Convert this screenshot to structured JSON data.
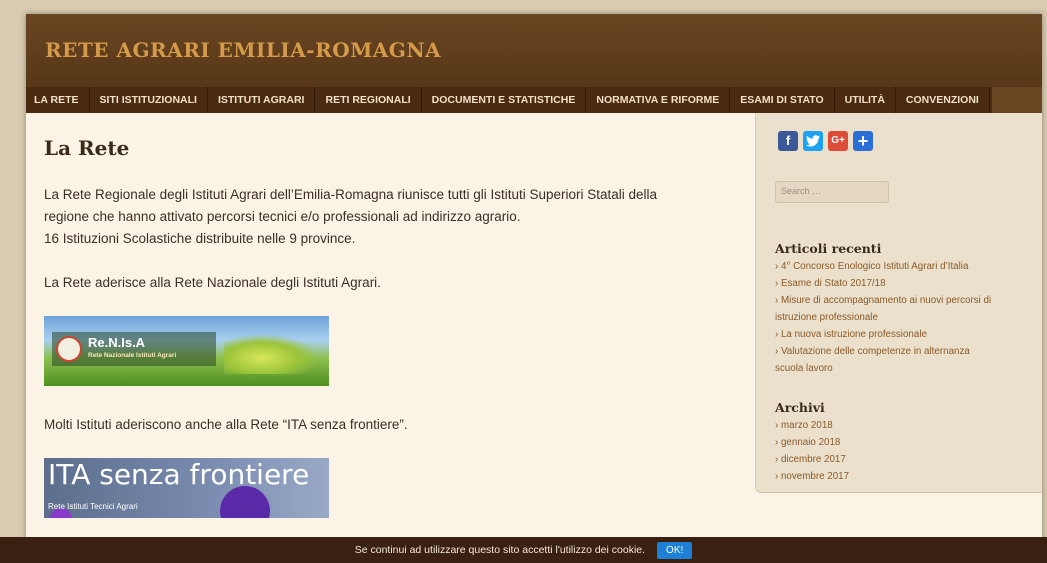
{
  "site": {
    "title": "RETE AGRARI EMILIA-ROMAGNA"
  },
  "nav": {
    "items": [
      "LA RETE",
      "SITI ISTITUZIONALI",
      "ISTITUTI AGRARI",
      "RETI REGIONALI",
      "DOCUMENTI E STATISTICHE",
      "NORMATIVA E RIFORME",
      "ESAMI DI STATO",
      "UTILITÀ",
      "CONVENZIONI"
    ]
  },
  "main": {
    "title": "La Rete",
    "p1_line1": "La Rete Regionale degli Istituti Agrari dell’Emilia-Romagna riunisce tutti gli Istituti Superiori Statali della",
    "p1_line2": "regione che hanno attivato percorsi tecnici e/o professionali ad indirizzo agrario.",
    "p1_line3": "16 Istituzioni Scolastiche distribuite nelle 9 province.",
    "p2": "La Rete aderisce alla Rete Nazionale degli Istituti Agrari.",
    "renisa_name": "Re.N.Is.A",
    "renisa_sub": "Rete Nazionale Istituti Agrari",
    "p3": "Molti Istituti aderiscono anche alla Rete “ITA senza frontiere”.",
    "ita_title": "ITA senza frontiere",
    "ita_sub": "Rete Istituti Tecnici Agrari"
  },
  "sidebar": {
    "share": [
      {
        "icon": "facebook-icon",
        "glyph": "f",
        "color": "#3b5998"
      },
      {
        "icon": "twitter-icon",
        "glyph": "t",
        "color": "#1da1f2"
      },
      {
        "icon": "google-plus-icon",
        "glyph": "G+",
        "color": "#dd4b39"
      },
      {
        "icon": "share-plus-icon",
        "glyph": "+",
        "color": "#2a6fd6"
      }
    ],
    "search_placeholder": "Search …",
    "recent": {
      "title": "Articoli recenti",
      "items": [
        "› 4° Concorso Enologico Istituti Agrari d’Italia",
        "› Esame di Stato 2017/18",
        "› Misure di accompagnamento ai nuovi percorsi di",
        "istruzione professionale",
        "› La nuova istruzione professionale",
        "› Valutazione delle competenze in alternanza",
        "scuola lavoro"
      ]
    },
    "archives": {
      "title": "Archivi",
      "items": [
        "› marzo 2018",
        "› gennaio 2018",
        "› dicembre 2017",
        "› novembre 2017"
      ]
    }
  },
  "cookie": {
    "text": "Se continui ad utilizzare questo sito accetti l'utilizzo dei cookie.",
    "ok_label": "OK!"
  }
}
